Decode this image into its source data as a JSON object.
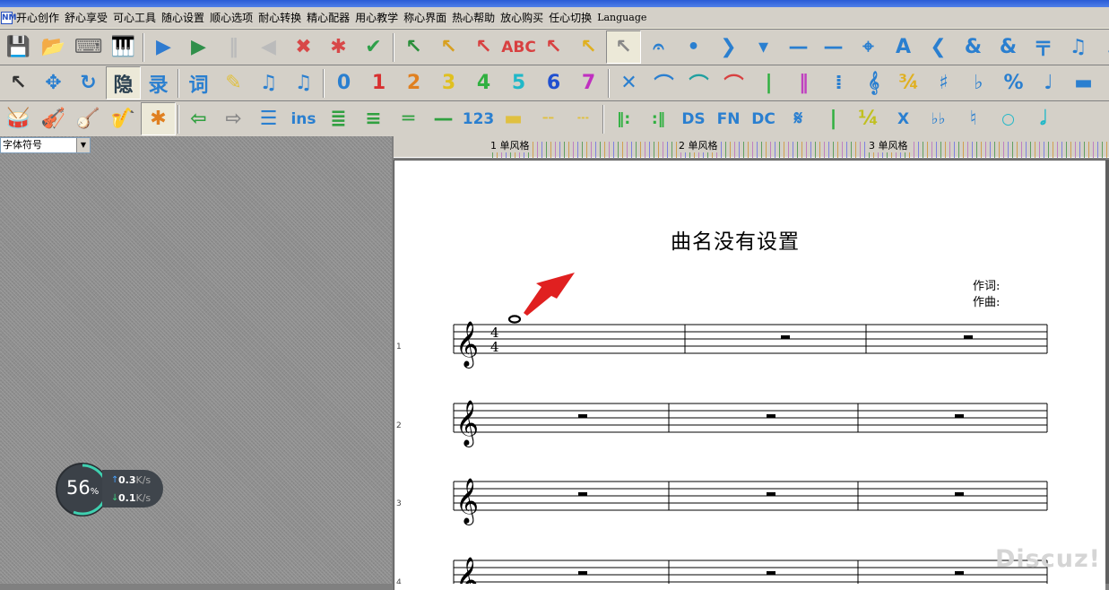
{
  "app": {
    "icon_text": "NM"
  },
  "menu": {
    "items": [
      "开心创作",
      "舒心享受",
      "可心工具",
      "随心设置",
      "顺心选项",
      "耐心转换",
      "精心配器",
      "用心教学",
      "称心界面",
      "热心帮助",
      "放心购买",
      "任心切换"
    ],
    "language": "Language"
  },
  "toolbar1": [
    {
      "name": "save-icon",
      "glyph": "💾",
      "color": "#1d5fb8"
    },
    {
      "name": "open-folder-icon",
      "glyph": "📂",
      "color": "#d7a230"
    },
    {
      "name": "keyboard-icon",
      "glyph": "⌨",
      "color": "#666"
    },
    {
      "name": "piano-keys-icon",
      "glyph": "🎹",
      "color": "#333"
    },
    {
      "name": "play-icon",
      "glyph": "▶",
      "color": "#2f7bd0"
    },
    {
      "name": "play-from-cursor-icon",
      "glyph": "▶",
      "color": "#2f8f4a"
    },
    {
      "name": "pause-icon",
      "glyph": "‖",
      "color": "#bbb"
    },
    {
      "name": "rewind-icon",
      "glyph": "◀",
      "color": "#bbb"
    },
    {
      "name": "delete-note-icon",
      "glyph": "✖",
      "color": "#d84848"
    },
    {
      "name": "cross-note-icon",
      "glyph": "✱",
      "color": "#d84848"
    },
    {
      "name": "check-icon",
      "glyph": "✔",
      "color": "#2fa04a"
    },
    {
      "name": "cursor-level-1-icon",
      "glyph": "↖",
      "color": "#2a8f3a"
    },
    {
      "name": "cursor-level-2-icon",
      "glyph": "↖",
      "color": "#d8a020"
    },
    {
      "name": "cursor-level-3-icon",
      "glyph": "↖",
      "color": "#d84040"
    },
    {
      "name": "spell-check-icon",
      "glyph": "ABC",
      "color": "#d84040",
      "small": true
    },
    {
      "name": "cursor-red-icon",
      "glyph": "↖",
      "color": "#d84040"
    },
    {
      "name": "cursor-traffic-icon",
      "glyph": "↖",
      "color": "#e0b020"
    },
    {
      "name": "cursor-select-icon",
      "glyph": "↖",
      "color": "#888",
      "pressed": true
    },
    {
      "name": "fermata-icon",
      "glyph": "𝄐",
      "color": "#2a7fd0"
    },
    {
      "name": "staccato-icon",
      "glyph": "•",
      "color": "#2a7fd0"
    },
    {
      "name": "accent-icon",
      "glyph": "❯",
      "color": "#2a7fd0"
    },
    {
      "name": "marcato-icon",
      "glyph": "▾",
      "color": "#2a7fd0"
    },
    {
      "name": "tenuto-icon",
      "glyph": "—",
      "color": "#2a7fd0"
    },
    {
      "name": "long-tenuto-icon",
      "glyph": "—",
      "color": "#2a7fd0"
    },
    {
      "name": "coda-icon",
      "glyph": "⌖",
      "color": "#2a7fd0"
    },
    {
      "name": "text-style-icon",
      "glyph": "A",
      "color": "#2a7fd0"
    },
    {
      "name": "decrescendo-icon",
      "glyph": "❮",
      "color": "#2a7fd0"
    },
    {
      "name": "add-staff-icon",
      "glyph": "&",
      "color": "#2a7fd0"
    },
    {
      "name": "remove-staff-icon",
      "glyph": "&",
      "color": "#2a7fd0"
    },
    {
      "name": "sign-icon",
      "glyph": "〒",
      "color": "#2a7fd0"
    },
    {
      "name": "eighth-notes-icon",
      "glyph": "♫",
      "color": "#2a7fd0"
    },
    {
      "name": "note-flag-icon",
      "glyph": "♪",
      "color": "#2a7fd0"
    }
  ],
  "toolbar2": [
    {
      "name": "arrow-cursor-icon",
      "glyph": "↖",
      "color": "#333"
    },
    {
      "name": "move-icon",
      "glyph": "✥",
      "color": "#2a7fd0"
    },
    {
      "name": "rotate-icon",
      "glyph": "↻",
      "color": "#2a7fd0"
    },
    {
      "name": "hide-icon",
      "glyph": "隐",
      "color": "#2a4050",
      "pressed": true
    },
    {
      "name": "record-icon",
      "glyph": "录",
      "color": "#2a7fd0"
    },
    {
      "name": "lyrics-icon",
      "glyph": "词",
      "color": "#2a7fd0"
    },
    {
      "name": "eraser-icon",
      "glyph": "✎",
      "color": "#e0c040"
    },
    {
      "name": "beam-notes-icon",
      "glyph": "♫",
      "color": "#2a7fd0"
    },
    {
      "name": "beam-notes-2-icon",
      "glyph": "♫",
      "color": "#2a7fd0"
    },
    {
      "name": "num-0-icon",
      "glyph": "0",
      "color": "#2a7fd0"
    },
    {
      "name": "num-1-icon",
      "glyph": "1",
      "color": "#d83030"
    },
    {
      "name": "num-2-icon",
      "glyph": "2",
      "color": "#e08020"
    },
    {
      "name": "num-3-icon",
      "glyph": "3",
      "color": "#e0c020"
    },
    {
      "name": "num-4-icon",
      "glyph": "4",
      "color": "#30b040"
    },
    {
      "name": "num-5-icon",
      "glyph": "5",
      "color": "#20b8c8"
    },
    {
      "name": "num-6-icon",
      "glyph": "6",
      "color": "#2050d0"
    },
    {
      "name": "num-7-icon",
      "glyph": "7",
      "color": "#c030c0"
    },
    {
      "name": "cross-icon",
      "glyph": "✕",
      "color": "#2a7fd0"
    },
    {
      "name": "tie-icon",
      "glyph": "⌒",
      "color": "#2a7fd0"
    },
    {
      "name": "slur-icon",
      "glyph": "⌒",
      "color": "#20a0a0"
    },
    {
      "name": "breath-icon",
      "glyph": "⌒",
      "color": "#d84040"
    },
    {
      "name": "barline-icon",
      "glyph": "|",
      "color": "#30b040"
    },
    {
      "name": "double-barline-icon",
      "glyph": "‖",
      "color": "#c040c0"
    },
    {
      "name": "repeat-sign-icon",
      "glyph": "⁞",
      "color": "#2a7fd0"
    },
    {
      "name": "treble-clef-icon",
      "glyph": "𝄞",
      "color": "#2a7fd0"
    },
    {
      "name": "time-sig-icon",
      "glyph": "¾",
      "color": "#e0b020"
    },
    {
      "name": "sharp-icon",
      "glyph": "♯",
      "color": "#2a7fd0"
    },
    {
      "name": "flat-icon",
      "glyph": "♭",
      "color": "#2a7fd0"
    },
    {
      "name": "percent-icon",
      "glyph": "%",
      "color": "#2a7fd0"
    },
    {
      "name": "quarter-note-icon",
      "glyph": "♩",
      "color": "#2a7fd0"
    },
    {
      "name": "whole-rest-icon",
      "glyph": "▬",
      "color": "#2a7fd0"
    }
  ],
  "toolbar3": [
    {
      "name": "drum-icon",
      "glyph": "🥁",
      "color": "#b04030"
    },
    {
      "name": "violin-icon",
      "glyph": "🎻",
      "color": "#8a4020"
    },
    {
      "name": "banjo-icon",
      "glyph": "🪕",
      "color": "#8a5a20"
    },
    {
      "name": "saxophone-icon",
      "glyph": "🎷",
      "color": "#d09020"
    },
    {
      "name": "asterisk-icon",
      "glyph": "✱",
      "color": "#e08020",
      "pressed": true
    },
    {
      "name": "arrow-left-icon",
      "glyph": "⇦",
      "color": "#30a040"
    },
    {
      "name": "arrow-right-icon",
      "glyph": "⇨",
      "color": "#888"
    },
    {
      "name": "align-icon",
      "glyph": "☰",
      "color": "#2a7fd0"
    },
    {
      "name": "insert-icon",
      "glyph": "ins",
      "color": "#2a7fd0",
      "small": true
    },
    {
      "name": "four-lines-icon",
      "glyph": "≣",
      "color": "#30a040"
    },
    {
      "name": "three-lines-icon",
      "glyph": "≡",
      "color": "#30a040"
    },
    {
      "name": "two-lines-icon",
      "glyph": "═",
      "color": "#30a040"
    },
    {
      "name": "one-line-icon",
      "glyph": "—",
      "color": "#30a040"
    },
    {
      "name": "numbered-123-icon",
      "glyph": "123",
      "color": "#2a7fd0",
      "small": true
    },
    {
      "name": "dash-line-icon",
      "glyph": "▬",
      "color": "#e0c040"
    },
    {
      "name": "dashed-line-icon",
      "glyph": "╌",
      "color": "#e0c040"
    },
    {
      "name": "dotted-line-icon",
      "glyph": "┄",
      "color": "#e0c040"
    },
    {
      "name": "repeat-start-icon",
      "glyph": "‖:",
      "color": "#30b040",
      "small": true
    },
    {
      "name": "repeat-end-icon",
      "glyph": ":‖",
      "color": "#30b040",
      "small": true
    },
    {
      "name": "dal-segno-icon",
      "glyph": "DS",
      "color": "#2a7fd0",
      "small": true
    },
    {
      "name": "fine-icon",
      "glyph": "FN",
      "color": "#2a7fd0",
      "small": true
    },
    {
      "name": "da-capo-icon",
      "glyph": "DC",
      "color": "#2a7fd0",
      "small": true
    },
    {
      "name": "segno-icon",
      "glyph": "𝄋",
      "color": "#2a7fd0"
    },
    {
      "name": "bar-green-icon",
      "glyph": "|",
      "color": "#30b040"
    },
    {
      "name": "time-sig-44-icon",
      "glyph": "¼",
      "color": "#c0c020"
    },
    {
      "name": "double-sharp-icon",
      "glyph": "X",
      "color": "#2a7fd0",
      "small": true
    },
    {
      "name": "double-flat-icon",
      "glyph": "♭♭",
      "color": "#2a7fd0",
      "small": true
    },
    {
      "name": "natural-icon",
      "glyph": "♮",
      "color": "#2a7fd0"
    },
    {
      "name": "whole-note-icon",
      "glyph": "○",
      "color": "#20b8c8",
      "small": true
    },
    {
      "name": "half-note-icon",
      "glyph": "𝅗𝅥",
      "color": "#20b8c8"
    }
  ],
  "font_select": {
    "value": "字体符号"
  },
  "ruler": {
    "labels": [
      "1  单风格",
      "2  单风格",
      "3  单风格"
    ]
  },
  "score": {
    "title": "曲名没有设置",
    "lyricist_label": "作词:",
    "composer_label": "作曲:",
    "time_signature": {
      "numerator": "4",
      "denominator": "4"
    },
    "systems": [
      {
        "number": "1",
        "measures": 3
      },
      {
        "number": "2",
        "measures": 3
      },
      {
        "number": "3",
        "measures": 3
      },
      {
        "number": "4",
        "measures": 3
      }
    ]
  },
  "net_widget": {
    "percent": "56",
    "percent_unit": "%",
    "upload": "0.3",
    "download": "0.1",
    "unit": "K/s"
  },
  "watermark": "Discuz!",
  "colors": {
    "annotation_arrow": "#e02020",
    "toolbar_bg": "#d4d0c8",
    "net_arc": "#3fd0b0"
  }
}
